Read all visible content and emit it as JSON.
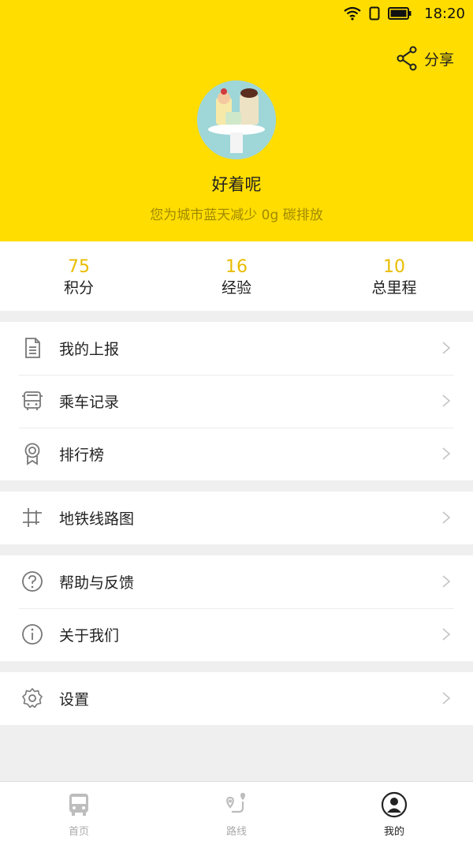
{
  "status": {
    "time": "18:20"
  },
  "header": {
    "share_label": "分享",
    "username": "好着呢",
    "slogan": "您为城市蓝天减少 0g 碳排放"
  },
  "stats": [
    {
      "value": "75",
      "label": "积分"
    },
    {
      "value": "16",
      "label": "经验"
    },
    {
      "value": "10",
      "label": "总里程"
    }
  ],
  "menu": {
    "report": "我的上报",
    "ride_records": "乘车记录",
    "leaderboard": "排行榜",
    "metro_map": "地铁线路图",
    "help": "帮助与反馈",
    "about": "关于我们",
    "settings": "设置"
  },
  "tabs": [
    {
      "label": "首页"
    },
    {
      "label": "路线"
    },
    {
      "label": "我的"
    }
  ],
  "colors": {
    "accent": "#ffdd00",
    "stat_value": "#e9bc00"
  }
}
